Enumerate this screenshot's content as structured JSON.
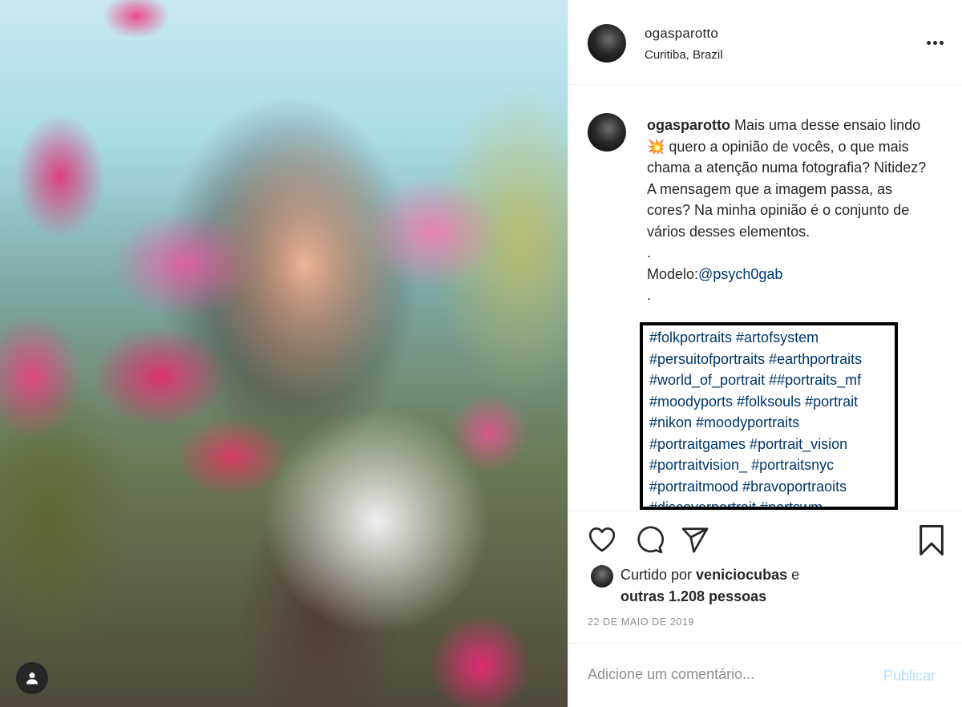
{
  "post": {
    "image_alt": "Portrait photo among pink flowers",
    "user_tag_icon": "user-icon"
  },
  "header": {
    "username": "ogasparotto",
    "location": "Curitiba, Brazil",
    "more_icon": "more-horizontal-icon"
  },
  "caption": {
    "username": "ogasparotto",
    "text": " Mais uma desse ensaio lindo 💥 quero a opinião de vocês, o que mais chama a atenção numa fotografia? Nitidez? A mensagem que a imagem passa, as cores? Na minha opinião é o conjunto de vários desses elementos.",
    "dot1": ".",
    "model_label": "Modelo:",
    "model_mention": "@psych0gab",
    "dot2": ".",
    "hashtag_lines": [
      "#folkportraits #artofsystem",
      "#persuitofportraits #earthportraits",
      "#world_of_portrait ##portraits_mf",
      "#moodyports #folksouls #portrait",
      "#nikon #moodyportraits",
      "#portraitgames #portrait_vision",
      "#portraitvision_ #portraitsnyc",
      "#portraitmood #bravoportraoits",
      "#discoverportrait #portswm"
    ]
  },
  "actions": {
    "like_icon": "heart-icon",
    "comment_icon": "comment-icon",
    "share_icon": "share-icon",
    "save_icon": "bookmark-icon"
  },
  "likes": {
    "prefix": "Curtido por ",
    "user": "veniciocubas",
    "middle": " e",
    "others": "outras 1.208 pessoas"
  },
  "date": "22 DE MAIO DE 2019",
  "comment_box": {
    "placeholder": "Adicione um comentário...",
    "publish_label": "Publicar"
  },
  "colors": {
    "text": "#262626",
    "link": "#00376b",
    "muted": "#8e8e8e",
    "publish_disabled": "#b2dffc"
  }
}
